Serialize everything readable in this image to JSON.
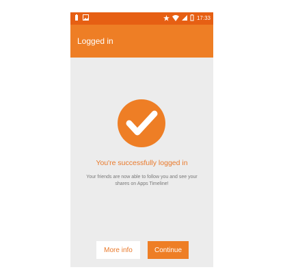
{
  "status_bar": {
    "time": "17:33",
    "icons": [
      "battery-icon",
      "image-icon",
      "star-icon",
      "wifi-icon",
      "signal-icon",
      "battery-icon"
    ]
  },
  "app_bar": {
    "title": "Logged in"
  },
  "content": {
    "icon": "checkmark-circle-icon",
    "title": "You're successfully logged in",
    "body": "Your friends are now able to follow you and see your shares on Apps Timeline!"
  },
  "buttons": {
    "more_info": "More info",
    "continue": "Continue"
  },
  "colors": {
    "accent": "#ee7e25",
    "status_bar": "#e65f13",
    "background": "#ececec",
    "text_secondary": "#777777"
  }
}
